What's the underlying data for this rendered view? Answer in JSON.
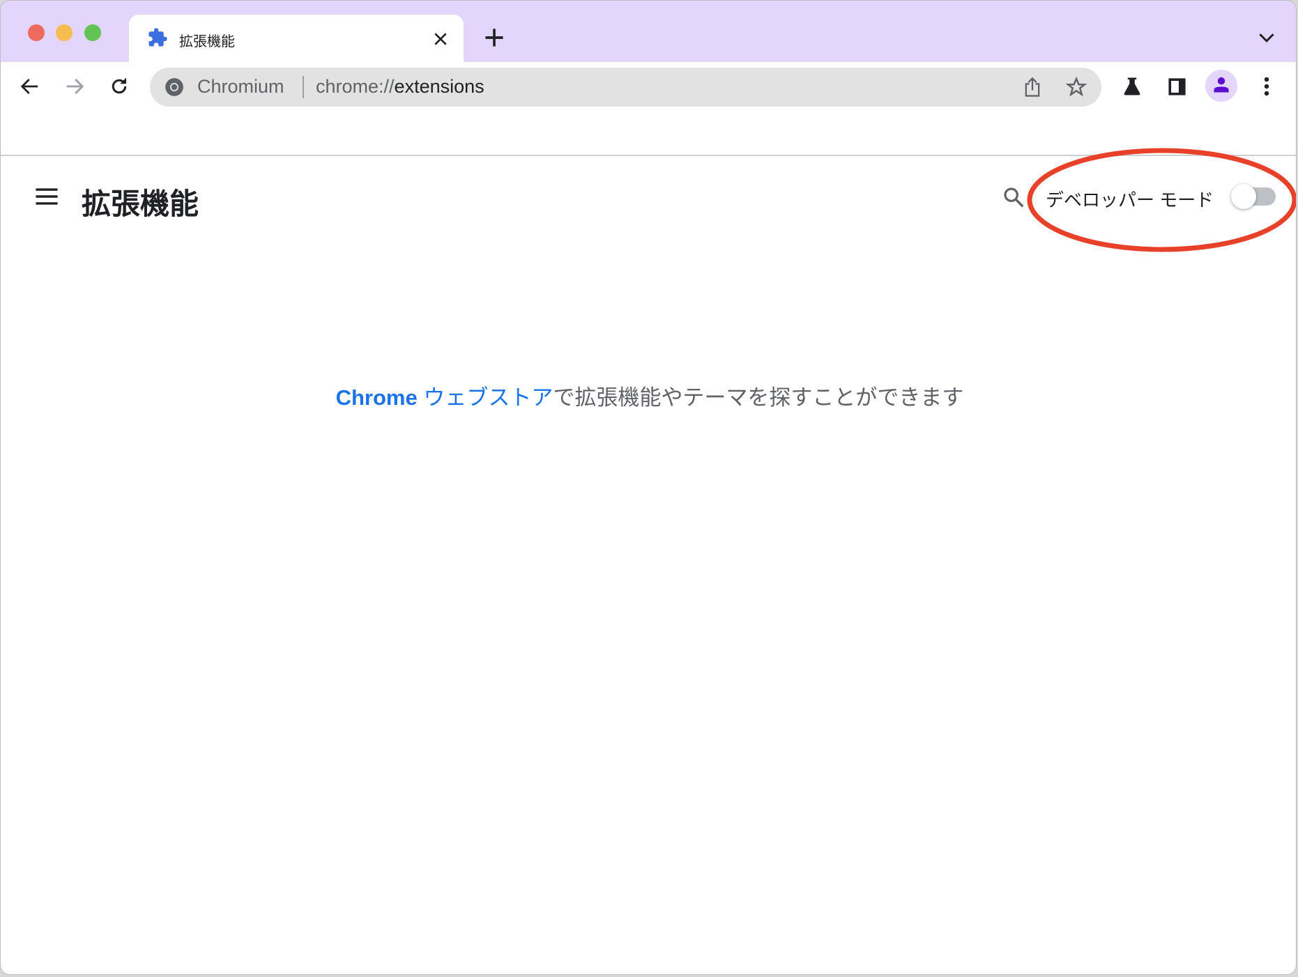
{
  "window": {
    "traffic_lights": [
      {
        "name": "close",
        "color": "#ee6a5f"
      },
      {
        "name": "minimize",
        "color": "#f5bd4f"
      },
      {
        "name": "zoom",
        "color": "#61c454"
      }
    ]
  },
  "tab": {
    "title": "拡張機能",
    "icon": "puzzle-icon"
  },
  "omnibox": {
    "host": "Chromium",
    "url_scheme": "chrome://",
    "url_path": "extensions"
  },
  "page": {
    "title": "拡張機能",
    "developer_mode_label": "デベロッパー モード",
    "developer_mode_on": false,
    "empty_link_brand": "Chrome",
    "empty_link_store": " ウェブストア",
    "empty_text": "で拡張機能やテーマを探すことができます"
  },
  "colors": {
    "tabbar": "#e3d5fb",
    "accent": "#1a73e8",
    "annotation": "#e8412a",
    "avatar": "#5d0fcf"
  }
}
